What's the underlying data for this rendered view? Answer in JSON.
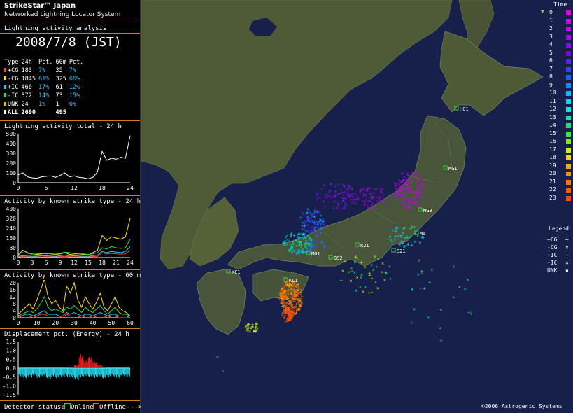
{
  "app": {
    "title": "StrikeStar™ Japan",
    "subtitle": "Networked Lightning Locator System"
  },
  "section_title": "Lightning activity analysis",
  "date": "2008/7/8 (JST)",
  "stats": {
    "headers": [
      "Type",
      "24h",
      "Pct.",
      "60m",
      "Pct."
    ],
    "rows": [
      {
        "type": "+CG",
        "h24": "183",
        "pct24": "7%",
        "m60": "35",
        "pct60": "7%",
        "color": "#ff4d2e"
      },
      {
        "type": "-CG",
        "h24": "1845",
        "pct24": "61%",
        "m60": "325",
        "pct60": "66%",
        "color": "#ffe400"
      },
      {
        "type": "+IC",
        "h24": "466",
        "pct24": "17%",
        "m60": "61",
        "pct60": "12%",
        "color": "#27c6ff"
      },
      {
        "type": "-IC",
        "h24": "372",
        "pct24": "14%",
        "m60": "73",
        "pct60": "15%",
        "color": "#33dd33"
      },
      {
        "type": "UNK",
        "h24": "24",
        "pct24": "1%",
        "m60": "1",
        "pct60": "0%",
        "color": "#ffb000"
      },
      {
        "type": "ALL",
        "h24": "2690",
        "pct24": "",
        "m60": "495",
        "pct60": "",
        "color": "#ffffff"
      }
    ]
  },
  "colors": {
    "accent": "#d47a1e",
    "online": "#3cd43c",
    "offline": "#d47a1e",
    "ocean": "#16204a"
  },
  "chart_titles": {
    "total": "Lightning activity total - 24 h",
    "by_type_24": "Activity by known strike type - 24 h",
    "by_type_60": "Activity by known strike type - 60 min",
    "displacement": "Displacement pct. (Energy) - 24 h"
  },
  "chart_data": [
    {
      "type": "line",
      "title": "Lightning activity total - 24 h",
      "x": [
        0,
        1,
        2,
        3,
        4,
        5,
        6,
        7,
        8,
        9,
        10,
        11,
        12,
        13,
        14,
        15,
        16,
        17,
        18,
        19,
        20,
        21,
        22,
        23,
        24
      ],
      "series": [
        {
          "values": [
            80,
            100,
            60,
            50,
            45,
            60,
            65,
            70,
            55,
            75,
            100,
            60,
            70,
            55,
            50,
            40,
            55,
            110,
            320,
            230,
            250,
            240,
            260,
            250,
            480
          ]
        }
      ],
      "ylim": [
        0,
        500
      ],
      "xticks": [
        "0",
        "6",
        "12",
        "18",
        "24"
      ],
      "yticks": [
        "0",
        "100",
        "200",
        "300",
        "400",
        "500"
      ]
    },
    {
      "type": "line",
      "title": "Activity by known strike type - 24 h",
      "x": [
        0,
        1,
        2,
        3,
        4,
        5,
        6,
        7,
        8,
        9,
        10,
        11,
        12,
        13,
        14,
        15,
        16,
        17,
        18,
        19,
        20,
        21,
        22,
        23,
        24
      ],
      "series": [
        {
          "color": "#ffe400",
          "values": [
            20,
            60,
            40,
            30,
            25,
            30,
            35,
            30,
            25,
            30,
            40,
            25,
            30,
            30,
            25,
            20,
            40,
            60,
            180,
            140,
            170,
            160,
            150,
            170,
            320
          ]
        },
        {
          "color": "#33dd33",
          "values": [
            30,
            40,
            35,
            28,
            30,
            35,
            30,
            32,
            28,
            35,
            45,
            40,
            35,
            30,
            30,
            25,
            30,
            40,
            80,
            70,
            90,
            80,
            75,
            80,
            150
          ]
        },
        {
          "color": "#27c6ff",
          "values": [
            10,
            15,
            12,
            10,
            12,
            14,
            15,
            12,
            10,
            15,
            20,
            12,
            15,
            12,
            10,
            10,
            15,
            20,
            50,
            40,
            50,
            45,
            40,
            50,
            90
          ]
        },
        {
          "color": "#ff4d2e",
          "values": [
            5,
            8,
            6,
            5,
            6,
            5,
            7,
            6,
            5,
            8,
            10,
            6,
            7,
            6,
            5,
            5,
            8,
            10,
            40,
            30,
            35,
            30,
            28,
            30,
            60
          ]
        }
      ],
      "ylim": [
        0,
        400
      ],
      "xticks": [
        "0",
        "3",
        "6",
        "9",
        "12",
        "15",
        "18",
        "21",
        "24"
      ],
      "yticks": [
        "0",
        "80",
        "160",
        "240",
        "320",
        "400"
      ]
    },
    {
      "type": "line",
      "title": "Activity by known strike type - 60 min",
      "x": [
        0,
        2,
        4,
        6,
        8,
        10,
        12,
        14,
        16,
        18,
        20,
        22,
        24,
        26,
        28,
        30,
        32,
        34,
        36,
        38,
        40,
        42,
        44,
        46,
        48,
        50,
        52,
        54,
        56,
        58,
        60
      ],
      "series": [
        {
          "color": "#ffe400",
          "values": [
            2,
            4,
            6,
            8,
            5,
            10,
            16,
            22,
            12,
            8,
            10,
            6,
            4,
            18,
            14,
            20,
            10,
            6,
            12,
            8,
            5,
            9,
            14,
            6,
            4,
            8,
            12,
            6,
            4,
            3,
            1
          ]
        },
        {
          "color": "#33dd33",
          "values": [
            1,
            2,
            3,
            4,
            3,
            5,
            8,
            12,
            6,
            4,
            5,
            4,
            3,
            6,
            5,
            7,
            5,
            3,
            6,
            4,
            3,
            5,
            7,
            4,
            2,
            4,
            6,
            3,
            2,
            2,
            1
          ]
        },
        {
          "color": "#27c6ff",
          "values": [
            0,
            1,
            2,
            2,
            1,
            2,
            3,
            4,
            2,
            2,
            2,
            1,
            1,
            3,
            2,
            3,
            2,
            1,
            2,
            2,
            1,
            2,
            3,
            2,
            1,
            2,
            2,
            1,
            1,
            1,
            0
          ]
        },
        {
          "color": "#ff4d2e",
          "values": [
            0,
            1,
            1,
            1,
            0,
            1,
            2,
            2,
            1,
            1,
            1,
            1,
            0,
            2,
            1,
            1,
            1,
            0,
            1,
            1,
            0,
            1,
            1,
            1,
            0,
            1,
            1,
            0,
            0,
            0,
            0
          ]
        }
      ],
      "ylim": [
        0,
        20
      ],
      "xticks": [
        "0",
        "10",
        "20",
        "30",
        "40",
        "50",
        "60"
      ],
      "yticks": [
        "0",
        "4",
        "8",
        "12",
        "16",
        "20"
      ]
    },
    {
      "type": "bar",
      "title": "Displacement pct. (Energy) - 24 h",
      "ylim": [
        -1.5,
        1.5
      ],
      "xlim": [
        0,
        24
      ],
      "series": [
        {
          "color": "#ff2020",
          "note_positive": true,
          "values": [
            0,
            0,
            0,
            0,
            0,
            0,
            0,
            0,
            0,
            0,
            0,
            0.1,
            0.2,
            0.9,
            0.5,
            0.7,
            0.4,
            0.2,
            0.1,
            0,
            0,
            0,
            0,
            0
          ]
        },
        {
          "color": "#27e8ff",
          "values": [
            -0.5,
            -0.6,
            -0.55,
            -0.5,
            -0.6,
            -0.5,
            -0.7,
            -0.5,
            -0.6,
            -0.55,
            -0.5,
            -0.6,
            -0.7,
            -0.6,
            -0.5,
            -0.55,
            -0.6,
            -0.5,
            -0.6,
            -0.55,
            -0.5,
            -0.6,
            -0.5,
            -0.55
          ]
        }
      ],
      "yticks": [
        "1.5",
        "1.0",
        "0.5",
        "0.0",
        "-0.5",
        "-1.0",
        "-1.5"
      ]
    }
  ],
  "legend": {
    "time_title": "Time",
    "hours": [
      "0",
      "1",
      "2",
      "3",
      "4",
      "5",
      "6",
      "7",
      "8",
      "9",
      "10",
      "11",
      "12",
      "13",
      "14",
      "15",
      "16",
      "17",
      "18",
      "19",
      "20",
      "21",
      "22",
      "23"
    ],
    "hour_colors": [
      "#e000e0",
      "#d800e8",
      "#c800f0",
      "#b400f4",
      "#9800f8",
      "#7c00ff",
      "#5a20ff",
      "#3a40ff",
      "#2060ff",
      "#0090ff",
      "#00b8ff",
      "#00d8f0",
      "#00e8c8",
      "#00f0a0",
      "#00f070",
      "#30f030",
      "#80f000",
      "#c8f000",
      "#ffd000",
      "#ffa800",
      "#ff9000",
      "#ff7800",
      "#ff6000",
      "#ff4800"
    ],
    "legend_title": "Legend",
    "types": [
      {
        "label": "+CG",
        "sym": "+"
      },
      {
        "label": "-CG",
        "sym": "×"
      },
      {
        "label": "+IC",
        "sym": "+"
      },
      {
        "label": "-IC",
        "sym": "×"
      },
      {
        "label": "UNK",
        "sym": "▪"
      }
    ]
  },
  "stations": [
    "H01",
    "MG1",
    "M4",
    "MG3",
    "MG1",
    "R21",
    "OS2",
    "S21",
    "KC1",
    "KC1"
  ],
  "footer": {
    "label": "Detector status:",
    "online": "Online",
    "offline": "Offline",
    "arrow": "--->"
  },
  "copyright": "©2006 Astrogenic Systems"
}
